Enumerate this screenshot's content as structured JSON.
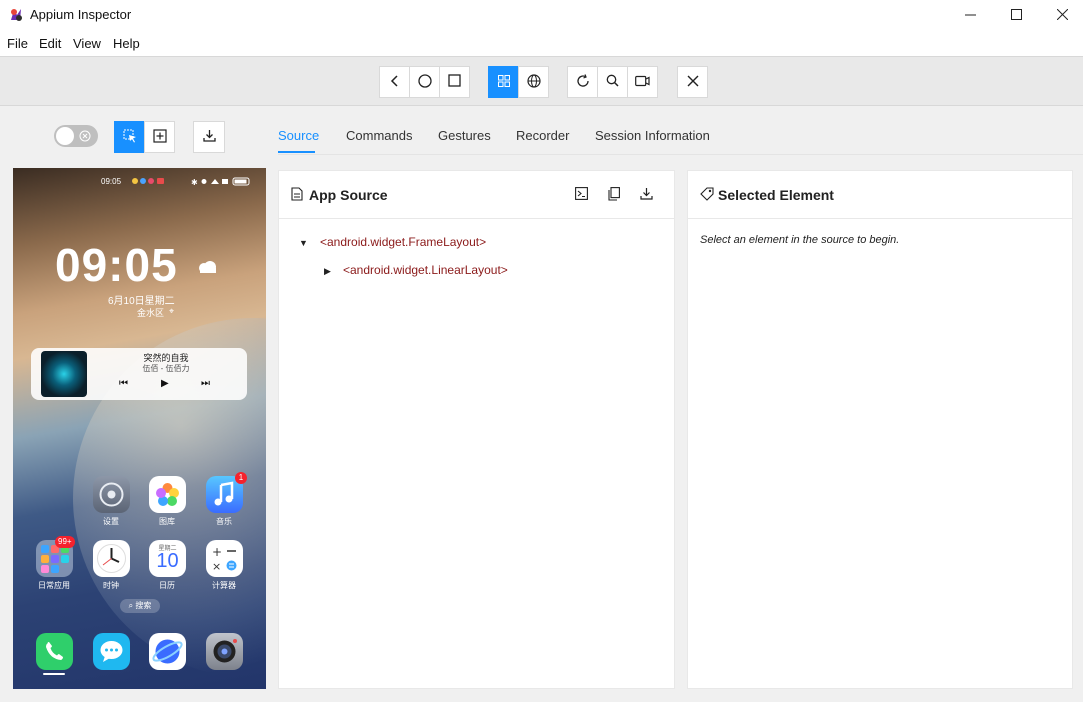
{
  "window": {
    "title": "Appium Inspector",
    "logo_icon": "appium-logo-icon",
    "controls": [
      "minimize-icon",
      "maximize-icon",
      "close-icon"
    ]
  },
  "menu": [
    "File",
    "Edit",
    "View",
    "Help"
  ],
  "toolbar": {
    "device_group": [
      "back-icon",
      "home-icon",
      "app-switch-icon"
    ],
    "mode_group": [
      {
        "icon": "native-grid-icon",
        "active": true
      },
      {
        "icon": "web-globe-icon",
        "active": false
      }
    ],
    "action_group": [
      "refresh-icon",
      "search-icon",
      "record-icon"
    ],
    "quit_icon": "close-icon"
  },
  "left_controls": {
    "toggle_on": false,
    "select_mode_active": true
  },
  "tabs": [
    {
      "label": "Source",
      "active": true
    },
    {
      "label": "Commands",
      "active": false
    },
    {
      "label": "Gestures",
      "active": false
    },
    {
      "label": "Recorder",
      "active": false
    },
    {
      "label": "Session Information",
      "active": false
    }
  ],
  "phone": {
    "status_time": "09:05",
    "clock": "09:05",
    "date": "6月10日星期二",
    "location": "金水区",
    "music": {
      "title": "突然的自我",
      "artist": "伍佰 - 伍佰力"
    },
    "apps_row1": [
      {
        "label": "设置",
        "icon": "settings-app-icon"
      },
      {
        "label": "图库",
        "icon": "gallery-app-icon"
      },
      {
        "label": "音乐",
        "icon": "music-app-icon",
        "badge": "1"
      }
    ],
    "apps_row2": [
      {
        "label": "日常应用",
        "icon": "folder-app-icon",
        "badge": "99+"
      },
      {
        "label": "时钟",
        "icon": "clock-app-icon"
      },
      {
        "label": "日历",
        "icon": "calendar-app-icon",
        "calendar_day": "10",
        "calendar_weekday": "星期二"
      },
      {
        "label": "计算器",
        "icon": "calculator-app-icon"
      }
    ],
    "search_label": "搜索",
    "dock": [
      "phone-app-icon",
      "messages-app-icon",
      "browser-app-icon",
      "camera-app-icon"
    ]
  },
  "source_panel": {
    "title": "App Source",
    "actions": [
      "terminal-icon",
      "copy-icon",
      "download-icon"
    ],
    "tree": [
      {
        "label": "<android.widget.FrameLayout>",
        "expanded": true
      },
      {
        "label": "<android.widget.LinearLayout>",
        "expanded": false
      }
    ]
  },
  "selected_panel": {
    "title": "Selected Element",
    "hint": "Select an element in the source to begin."
  },
  "colors": {
    "accent": "#1890ff",
    "tree_text": "#8b1a1a"
  }
}
